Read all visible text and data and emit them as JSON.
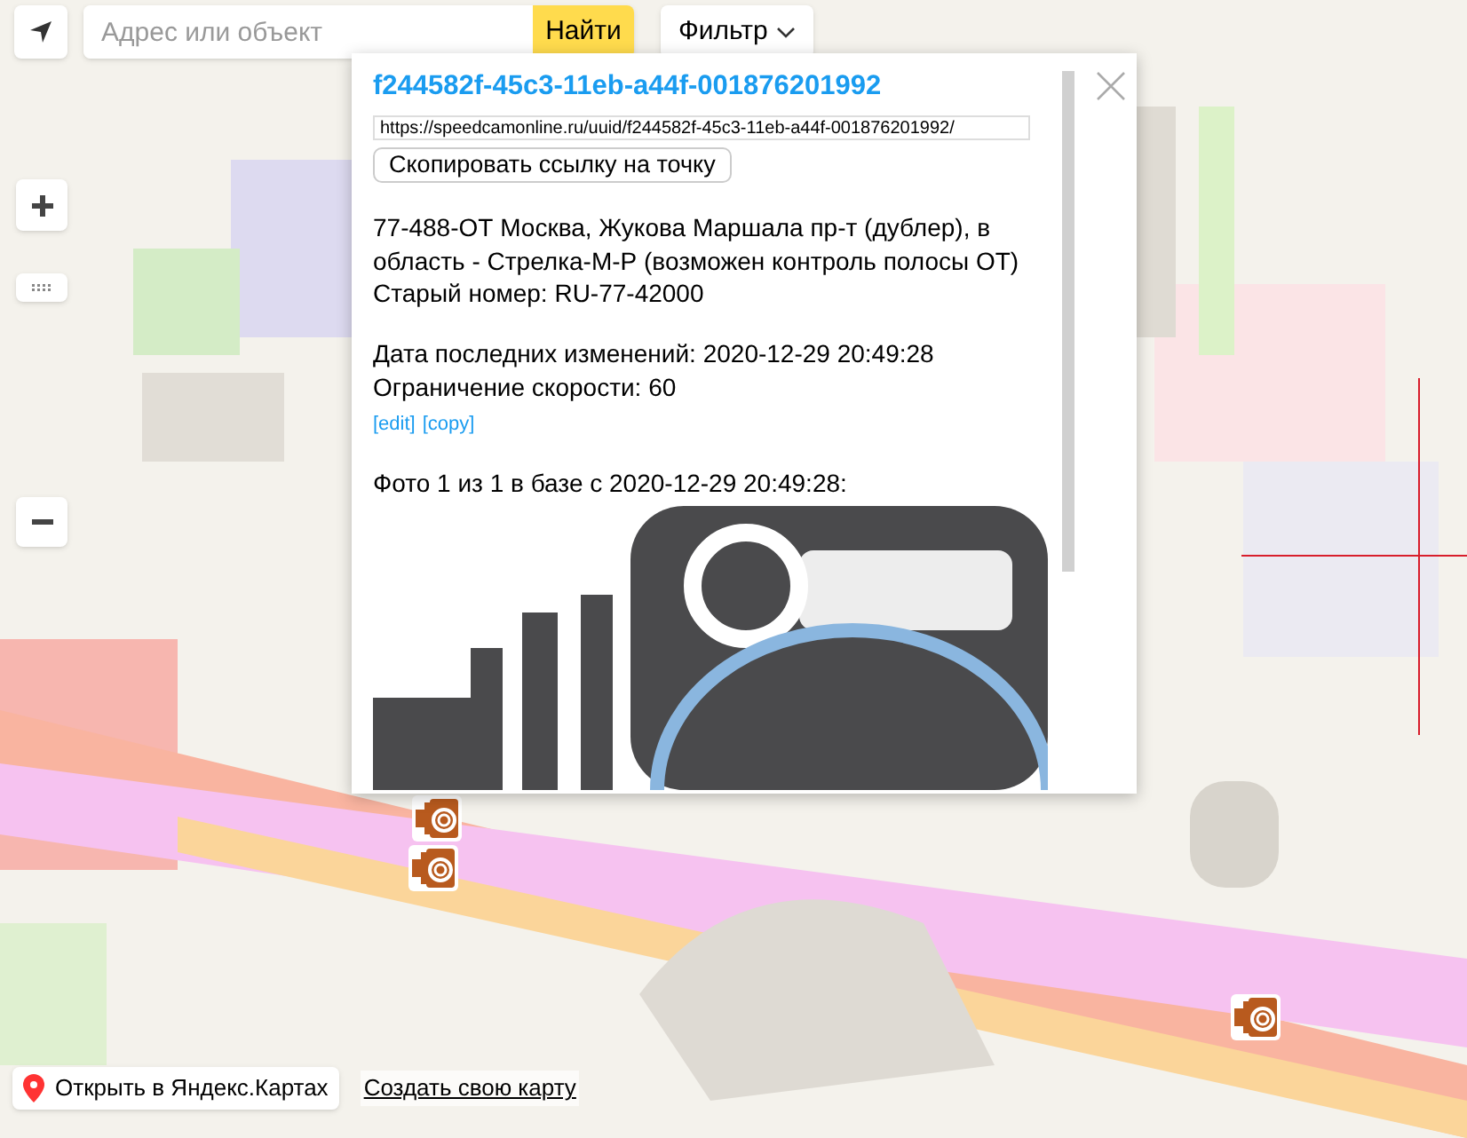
{
  "search": {
    "placeholder": "Адрес или объект",
    "button": "Найти"
  },
  "filter": {
    "label": "Фильтр"
  },
  "popup": {
    "title": "f244582f-45c3-11eb-a44f-001876201992",
    "url": "https://speedcamonline.ru/uuid/f244582f-45c3-11eb-a44f-001876201992/",
    "copy_button": "Скопировать ссылку на точку",
    "address": "77-488-ОТ Москва, Жукова Маршала пр-т (дублер), в область - Стрелка-М-Р (возможен контроль полосы ОТ)",
    "old_number": "Старый номер: RU-77-42000",
    "details": [
      "Дата последних изменений: 2020-12-29 20:49:28",
      "Ограничение скорости: 60"
    ],
    "links": [
      "[edit]",
      "[copy]"
    ],
    "photo_caption": "Фото 1 из 1 в базе с 2020-12-29 20:49:28:"
  },
  "footer": {
    "open_button": "Открыть в Яндекс.Картах",
    "create_link": "Создать свою карту"
  }
}
